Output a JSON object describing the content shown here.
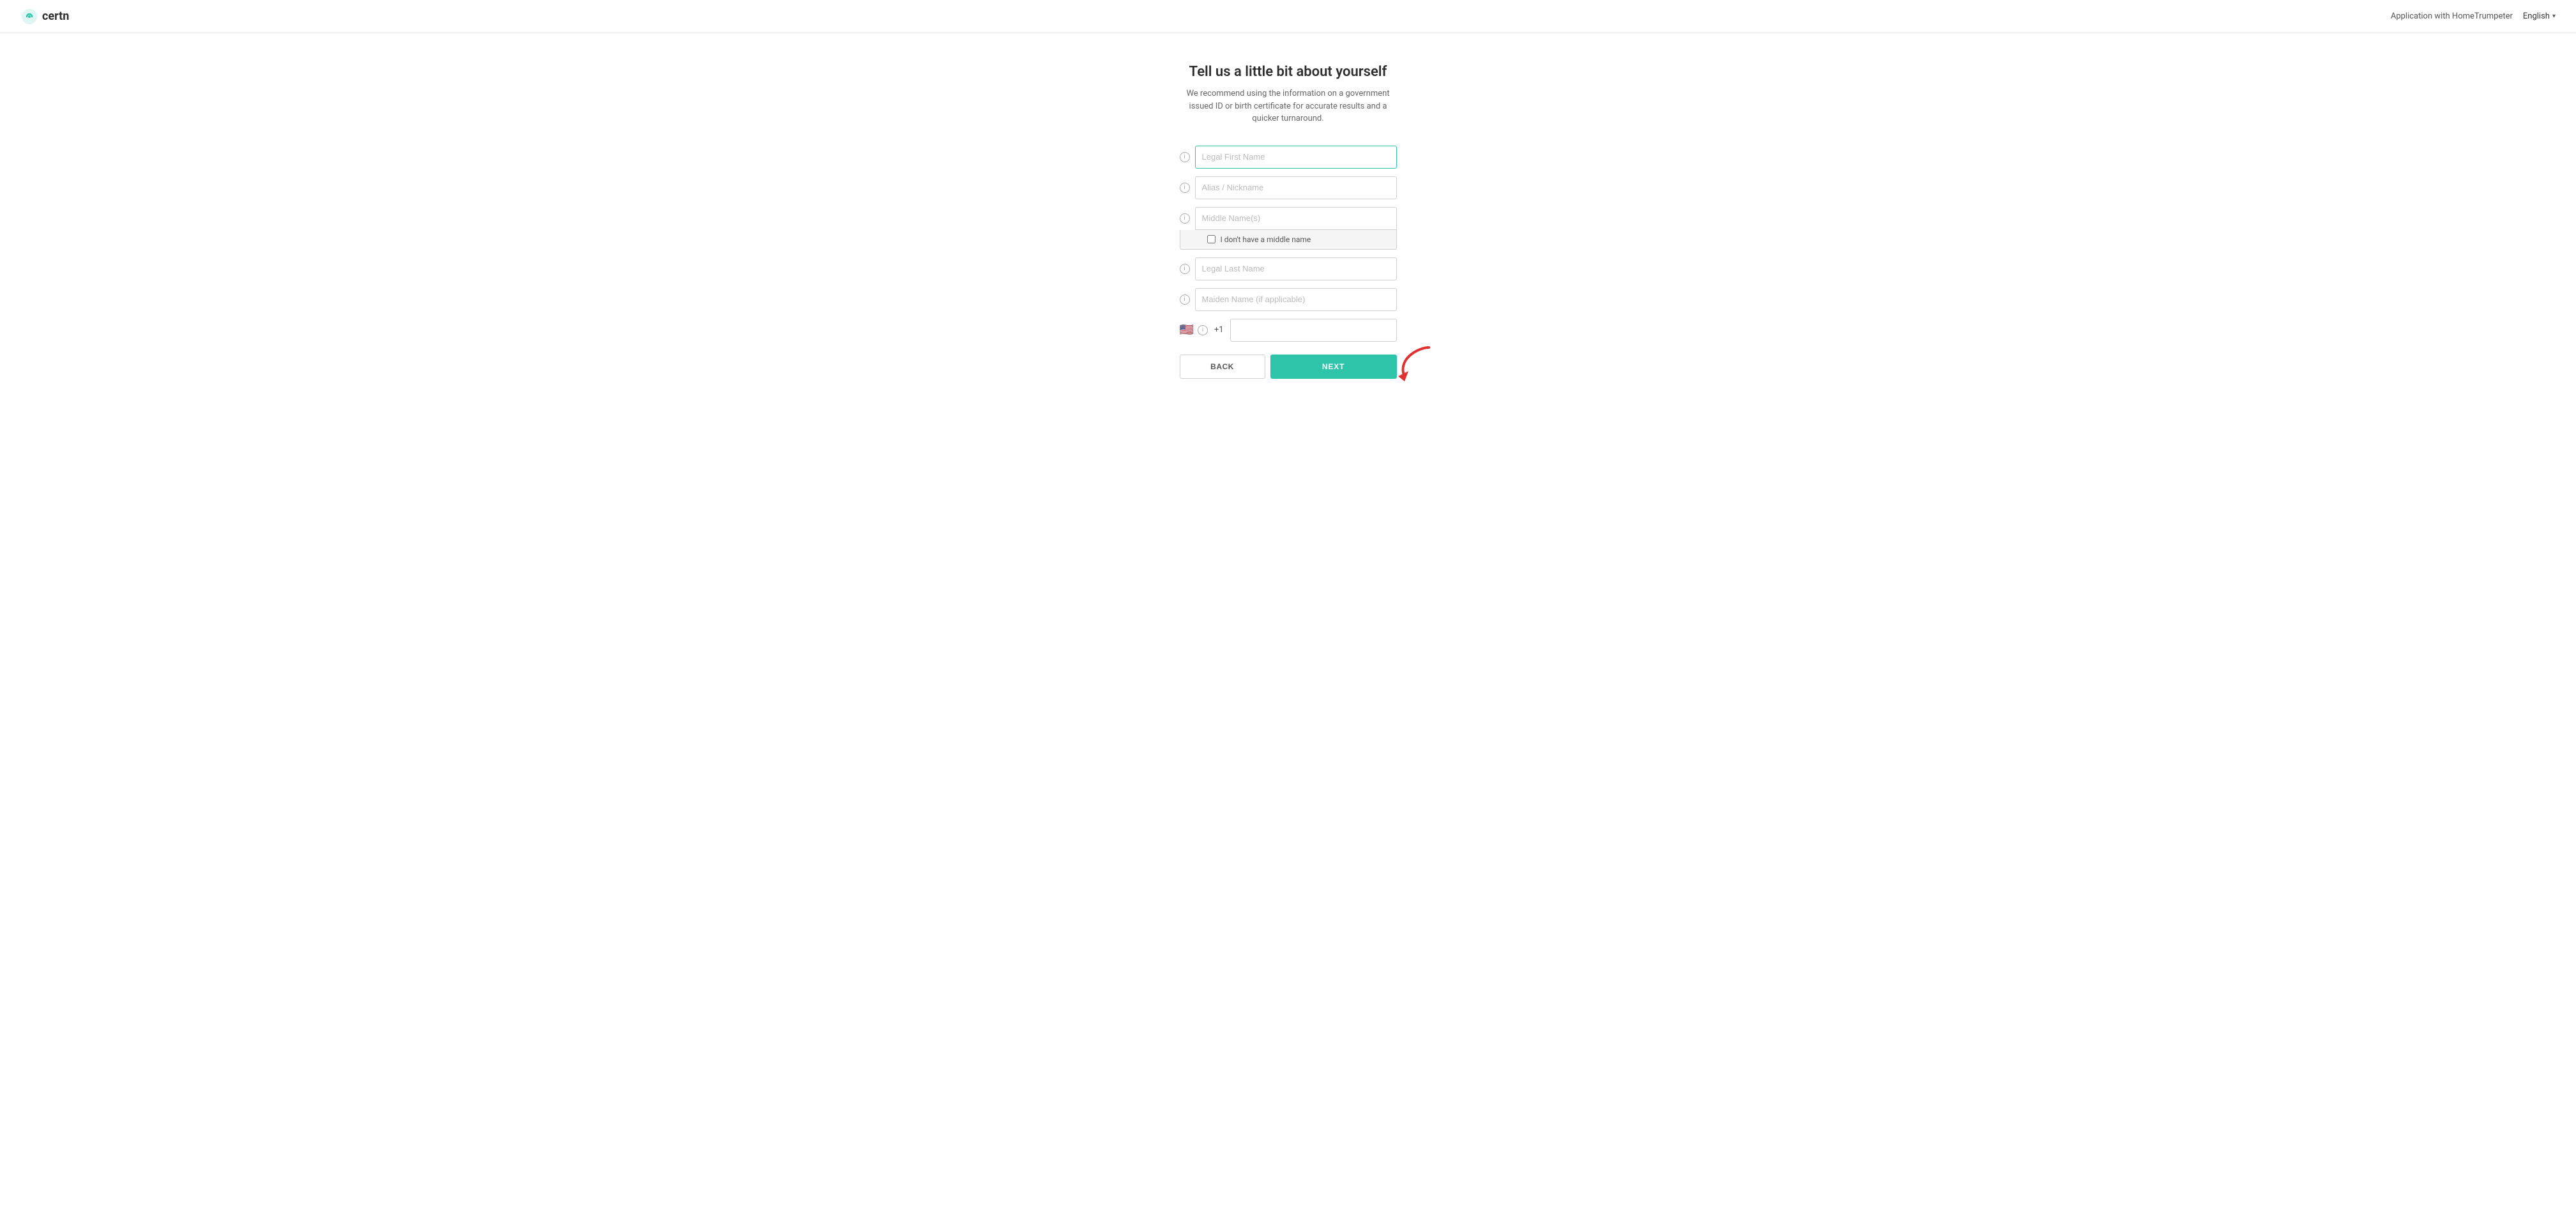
{
  "header": {
    "logo_text": "certn",
    "app_name": "Application with HomeTrumpeter",
    "language": "English"
  },
  "page": {
    "title": "Tell us a little bit about yourself",
    "subtitle": "We recommend using the information on a government issued ID or birth certificate for accurate results and a quicker turnaround."
  },
  "form": {
    "fields": {
      "legal_first_name_placeholder": "Legal First Name",
      "alias_nickname_placeholder": "Alias / Nickname",
      "middle_name_placeholder": "Middle Name(s)",
      "no_middle_name_label": "I don't have a middle name",
      "legal_last_name_placeholder": "Legal Last Name",
      "maiden_name_placeholder": "Maiden Name (if applicable)",
      "phone_prefix": "+1"
    }
  },
  "buttons": {
    "back_label": "BACK",
    "next_label": "NEXT"
  }
}
